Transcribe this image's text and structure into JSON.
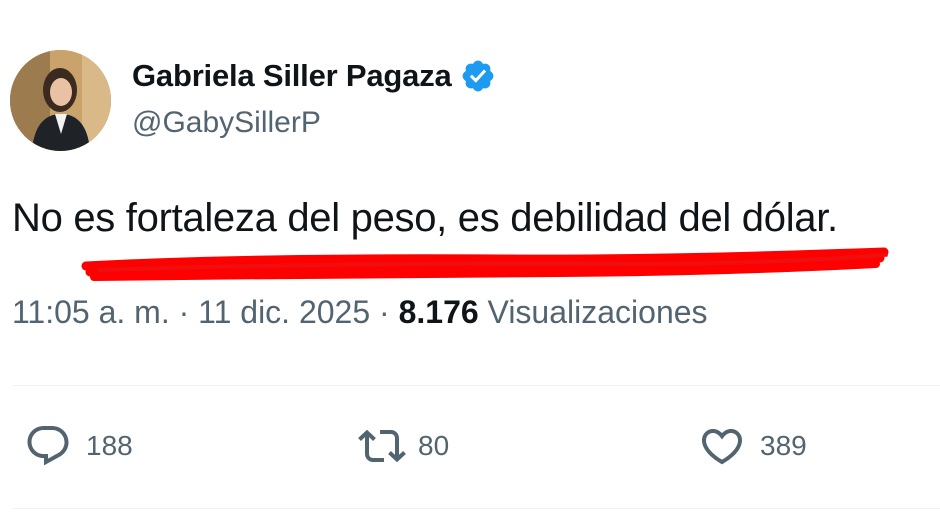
{
  "author": {
    "display_name": "Gabriela Siller Pagaza",
    "handle": "@GabySillerP",
    "verified": true,
    "avatar_icon": "avatar-photo"
  },
  "tweet": {
    "text": "No es fortaleza del peso, es debilidad del dólar.",
    "time": "11:05 a. m.",
    "separator": "·",
    "date": "11 dic. 2025",
    "views_count": "8.176",
    "views_label": "Visualizaciones"
  },
  "actions": {
    "reply": {
      "icon": "reply-icon",
      "count": "188"
    },
    "retweet": {
      "icon": "retweet-icon",
      "count": "80"
    },
    "like": {
      "icon": "heart-icon",
      "count": "389"
    }
  },
  "colors": {
    "text_primary": "#0f1419",
    "text_secondary": "#536471",
    "verified_blue": "#1d9bf0",
    "underline_red": "#ff0000",
    "divider": "#eff3f4"
  }
}
